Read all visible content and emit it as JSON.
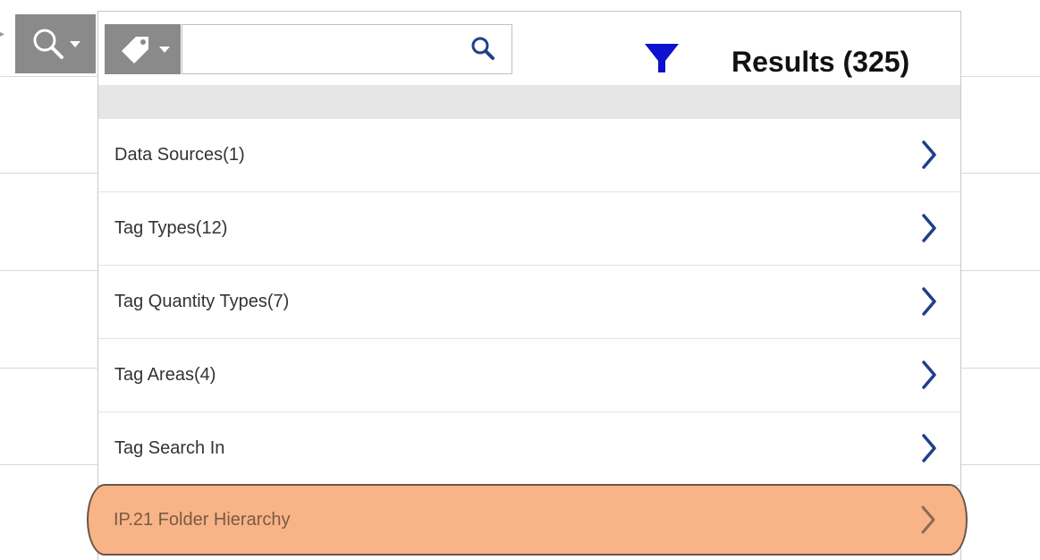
{
  "search": {
    "value": "",
    "placeholder": ""
  },
  "results": {
    "label": "Results (325)"
  },
  "filters": [
    {
      "label": "Data Sources(1)"
    },
    {
      "label": "Tag Types(12)"
    },
    {
      "label": "Tag Quantity Types(7)"
    },
    {
      "label": "Tag Areas(4)"
    },
    {
      "label": "Tag Search In"
    },
    {
      "label": "IP.21 Folder Hierarchy",
      "highlighted": true
    }
  ],
  "colors": {
    "accent": "#1e3f8a",
    "filter_icon": "#1010d0",
    "highlight": "#f8b487",
    "toolbar_button": "#8a8a8a"
  },
  "icons": {
    "search_dropdown": "search-icon",
    "tag_dropdown": "tag-icon",
    "search_button": "search-icon",
    "filter_tab": "filter-funnel-icon",
    "row_arrow": "chevron-right-icon"
  }
}
